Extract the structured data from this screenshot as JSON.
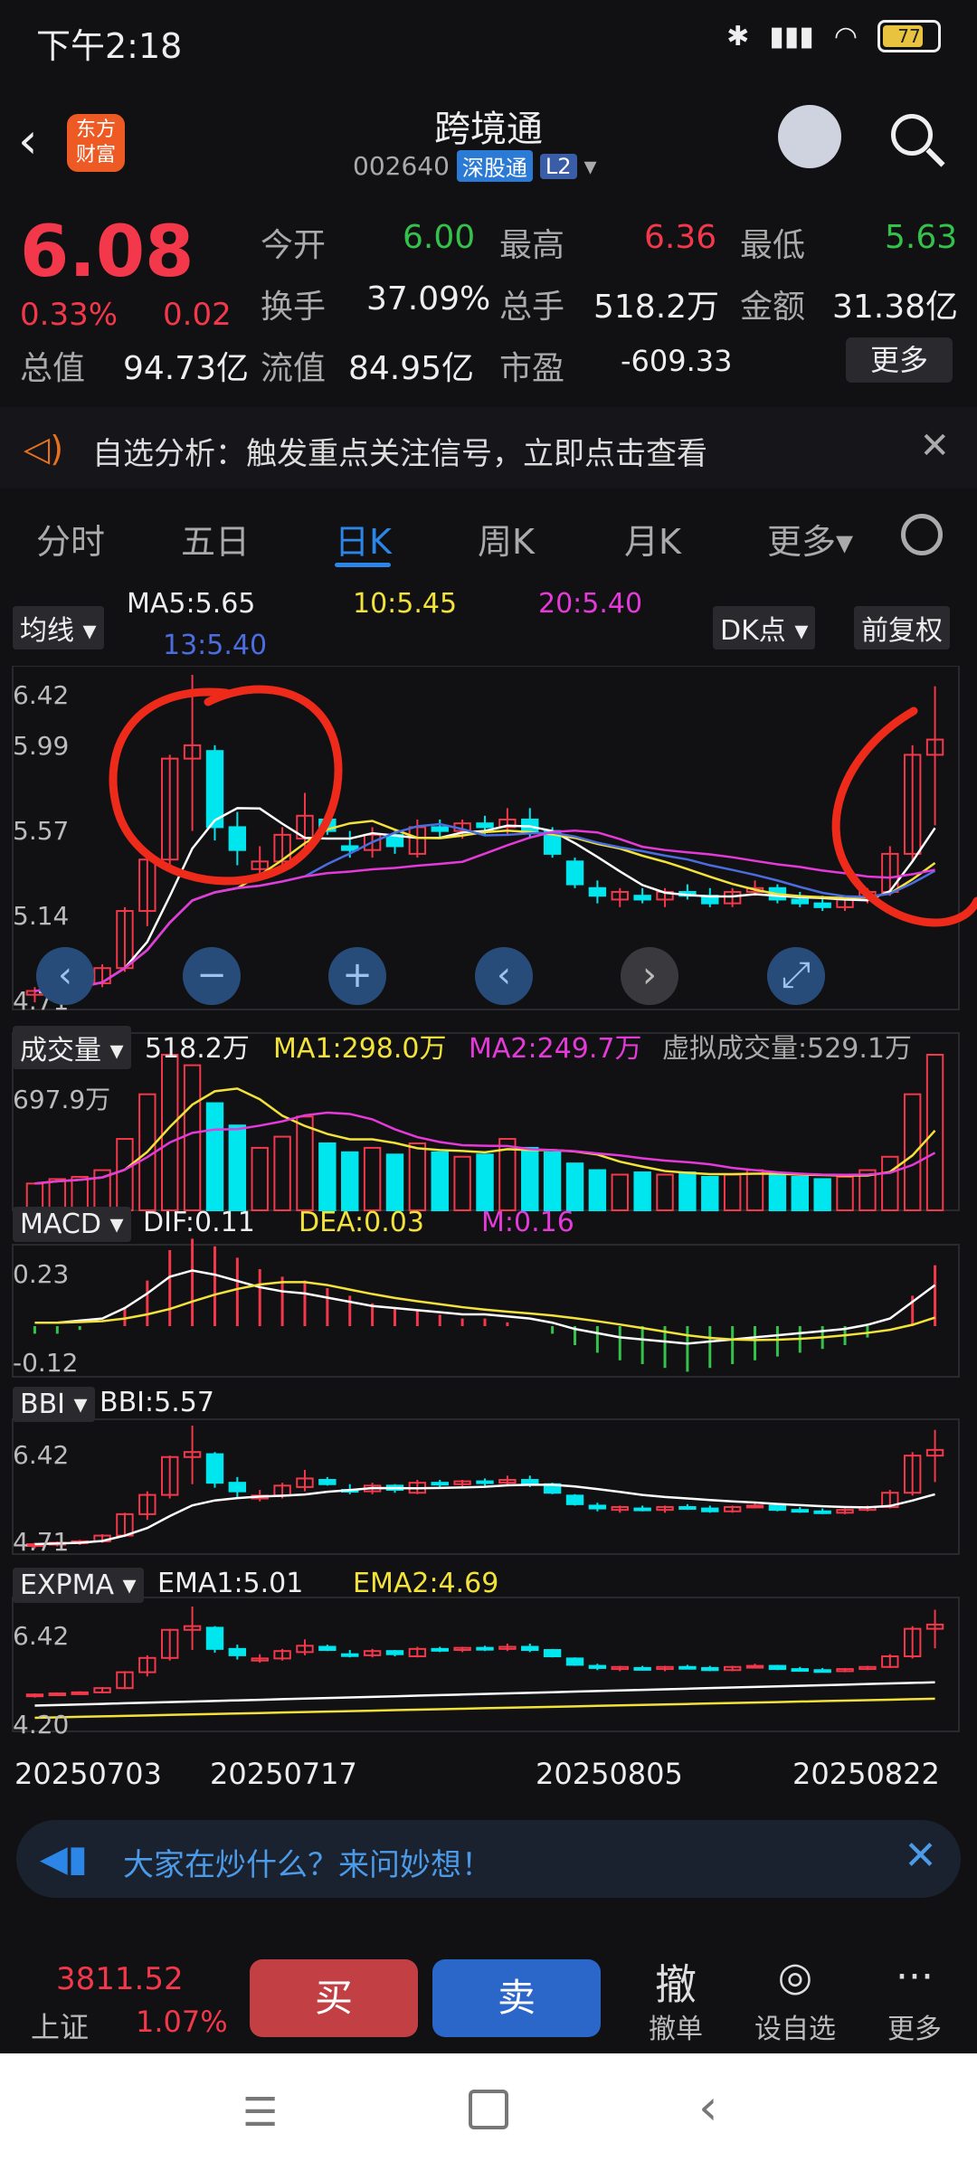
{
  "status_bar": {
    "time": "下午2:18",
    "battery": "77"
  },
  "header": {
    "logo_text": "东方财富",
    "stock_name": "跨境通",
    "stock_code": "002640",
    "tag_market": "深股通",
    "tag_level": "L2"
  },
  "quote": {
    "price": "6.08",
    "change_pct": "0.33%",
    "change_amt": "0.02",
    "rows": [
      [
        {
          "label": "今开",
          "value": "6.00",
          "color": "#35c24a"
        },
        {
          "label": "最高",
          "value": "6.36",
          "color": "#f2384a"
        },
        {
          "label": "最低",
          "value": "5.63",
          "color": "#35c24a"
        }
      ],
      [
        {
          "label": "换手",
          "value": "37.09%",
          "color": "#eeeeee"
        },
        {
          "label": "总手",
          "value": "518.2万",
          "color": "#eeeeee"
        },
        {
          "label": "金额",
          "value": "31.38亿",
          "color": "#eeeeee"
        }
      ],
      [
        {
          "label": "总值",
          "value": "94.73亿",
          "color": "#eeeeee"
        },
        {
          "label": "流值",
          "value": "84.95亿",
          "color": "#eeeeee"
        },
        {
          "label": "市盈",
          "value": "-609.33",
          "color": "#eeeeee"
        }
      ]
    ],
    "more_label": "更多"
  },
  "notice": {
    "text": "自选分析：触发重点关注信号，立即点击查看"
  },
  "tabs": [
    "分时",
    "五日",
    "日K",
    "周K",
    "月K",
    "更多"
  ],
  "active_tab": "日K",
  "main_chart": {
    "indicator_label": "均线",
    "ma5": "MA5:5.65",
    "ma10": "10:5.45",
    "ma20": "20:5.40",
    "ma13": "13:5.40",
    "dk_label": "DK点",
    "adjust_label": "前复权",
    "yticks": [
      "6.42",
      "5.99",
      "5.57",
      "5.14",
      "4.71"
    ]
  },
  "volume_panel": {
    "label": "成交量",
    "value": "518.2万",
    "ma1": "MA1:298.0万",
    "ma2": "MA2:249.7万",
    "virtual": "虚拟成交量:529.1万",
    "ytick": "697.9万"
  },
  "macd_panel": {
    "label": "MACD",
    "dif": "DIF:0.11",
    "dea": "DEA:0.03",
    "m": "M:0.16",
    "yticks": [
      "0.23",
      "-0.12"
    ]
  },
  "bbi_panel": {
    "label": "BBI",
    "bbi": "BBI:5.57",
    "yticks": [
      "6.42",
      "4.71"
    ]
  },
  "expma_panel": {
    "label": "EXPMA",
    "ema1": "EMA1:5.01",
    "ema2": "EMA2:4.69",
    "yticks": [
      "6.42",
      "4.20"
    ]
  },
  "dates": [
    "20250703",
    "20250717",
    "20250805",
    "20250822"
  ],
  "chart_data": {
    "type": "candlestick",
    "ylim": [
      4.71,
      6.42
    ],
    "candles": [
      {
        "o": 4.74,
        "h": 4.78,
        "l": 4.7,
        "c": 4.76
      },
      {
        "o": 4.76,
        "h": 4.8,
        "l": 4.73,
        "c": 4.78
      },
      {
        "o": 4.78,
        "h": 4.82,
        "l": 4.75,
        "c": 4.8
      },
      {
        "o": 4.8,
        "h": 4.9,
        "l": 4.78,
        "c": 4.88
      },
      {
        "o": 4.88,
        "h": 5.2,
        "l": 4.86,
        "c": 5.18
      },
      {
        "o": 5.18,
        "h": 5.5,
        "l": 5.1,
        "c": 5.45
      },
      {
        "o": 5.45,
        "h": 6.0,
        "l": 5.4,
        "c": 5.98
      },
      {
        "o": 5.98,
        "h": 6.42,
        "l": 5.6,
        "c": 6.05
      },
      {
        "o": 6.02,
        "h": 6.05,
        "l": 5.55,
        "c": 5.62
      },
      {
        "o": 5.62,
        "h": 5.7,
        "l": 5.42,
        "c": 5.5
      },
      {
        "o": 5.4,
        "h": 5.52,
        "l": 5.36,
        "c": 5.44
      },
      {
        "o": 5.44,
        "h": 5.62,
        "l": 5.4,
        "c": 5.58
      },
      {
        "o": 5.56,
        "h": 5.8,
        "l": 5.5,
        "c": 5.68
      },
      {
        "o": 5.66,
        "h": 5.7,
        "l": 5.58,
        "c": 5.6
      },
      {
        "o": 5.52,
        "h": 5.6,
        "l": 5.46,
        "c": 5.5
      },
      {
        "o": 5.5,
        "h": 5.62,
        "l": 5.46,
        "c": 5.58
      },
      {
        "o": 5.58,
        "h": 5.6,
        "l": 5.48,
        "c": 5.52
      },
      {
        "o": 5.48,
        "h": 5.66,
        "l": 5.46,
        "c": 5.62
      },
      {
        "o": 5.62,
        "h": 5.66,
        "l": 5.56,
        "c": 5.6
      },
      {
        "o": 5.6,
        "h": 5.66,
        "l": 5.56,
        "c": 5.64
      },
      {
        "o": 5.64,
        "h": 5.68,
        "l": 5.58,
        "c": 5.62
      },
      {
        "o": 5.62,
        "h": 5.72,
        "l": 5.58,
        "c": 5.66
      },
      {
        "o": 5.66,
        "h": 5.72,
        "l": 5.56,
        "c": 5.6
      },
      {
        "o": 5.6,
        "h": 5.62,
        "l": 5.46,
        "c": 5.48
      },
      {
        "o": 5.44,
        "h": 5.46,
        "l": 5.3,
        "c": 5.32
      },
      {
        "o": 5.3,
        "h": 5.34,
        "l": 5.22,
        "c": 5.26
      },
      {
        "o": 5.24,
        "h": 5.3,
        "l": 5.2,
        "c": 5.28
      },
      {
        "o": 5.26,
        "h": 5.3,
        "l": 5.22,
        "c": 5.24
      },
      {
        "o": 5.24,
        "h": 5.3,
        "l": 5.2,
        "c": 5.28
      },
      {
        "o": 5.28,
        "h": 5.32,
        "l": 5.24,
        "c": 5.26
      },
      {
        "o": 5.26,
        "h": 5.3,
        "l": 5.2,
        "c": 5.22
      },
      {
        "o": 5.22,
        "h": 5.3,
        "l": 5.2,
        "c": 5.28
      },
      {
        "o": 5.28,
        "h": 5.34,
        "l": 5.26,
        "c": 5.3
      },
      {
        "o": 5.3,
        "h": 5.32,
        "l": 5.22,
        "c": 5.24
      },
      {
        "o": 5.24,
        "h": 5.28,
        "l": 5.2,
        "c": 5.22
      },
      {
        "o": 5.22,
        "h": 5.26,
        "l": 5.18,
        "c": 5.2
      },
      {
        "o": 5.2,
        "h": 5.26,
        "l": 5.18,
        "c": 5.24
      },
      {
        "o": 5.24,
        "h": 5.3,
        "l": 5.22,
        "c": 5.28
      },
      {
        "o": 5.28,
        "h": 5.52,
        "l": 5.26,
        "c": 5.48
      },
      {
        "o": 5.48,
        "h": 6.05,
        "l": 5.44,
        "c": 6.0
      },
      {
        "o": 6.0,
        "h": 6.36,
        "l": 5.63,
        "c": 6.08
      }
    ],
    "volume": [
      120,
      140,
      150,
      180,
      320,
      520,
      697,
      650,
      480,
      380,
      280,
      330,
      420,
      300,
      260,
      280,
      250,
      300,
      260,
      240,
      250,
      320,
      280,
      260,
      210,
      180,
      160,
      170,
      160,
      170,
      150,
      160,
      180,
      160,
      150,
      140,
      150,
      180,
      240,
      520,
      697
    ],
    "macd_m": [
      -0.02,
      -0.02,
      -0.01,
      0.0,
      0.05,
      0.12,
      0.2,
      0.23,
      0.21,
      0.18,
      0.15,
      0.13,
      0.12,
      0.1,
      0.08,
      0.06,
      0.05,
      0.04,
      0.03,
      0.02,
      0.02,
      0.01,
      0.0,
      -0.02,
      -0.05,
      -0.07,
      -0.09,
      -0.1,
      -0.11,
      -0.12,
      -0.11,
      -0.1,
      -0.09,
      -0.08,
      -0.07,
      -0.06,
      -0.05,
      -0.03,
      0.0,
      0.08,
      0.16
    ]
  },
  "ask_bar": {
    "text": "大家在炒什么？来问妙想！"
  },
  "bottom_bar": {
    "index_value": "3811.52",
    "index_name": "上证",
    "index_pct": "1.07%",
    "buy": "买",
    "sell": "卖",
    "cancel_big": "撤",
    "cancel": "撤单",
    "watch": "设自选",
    "more": "更多"
  }
}
